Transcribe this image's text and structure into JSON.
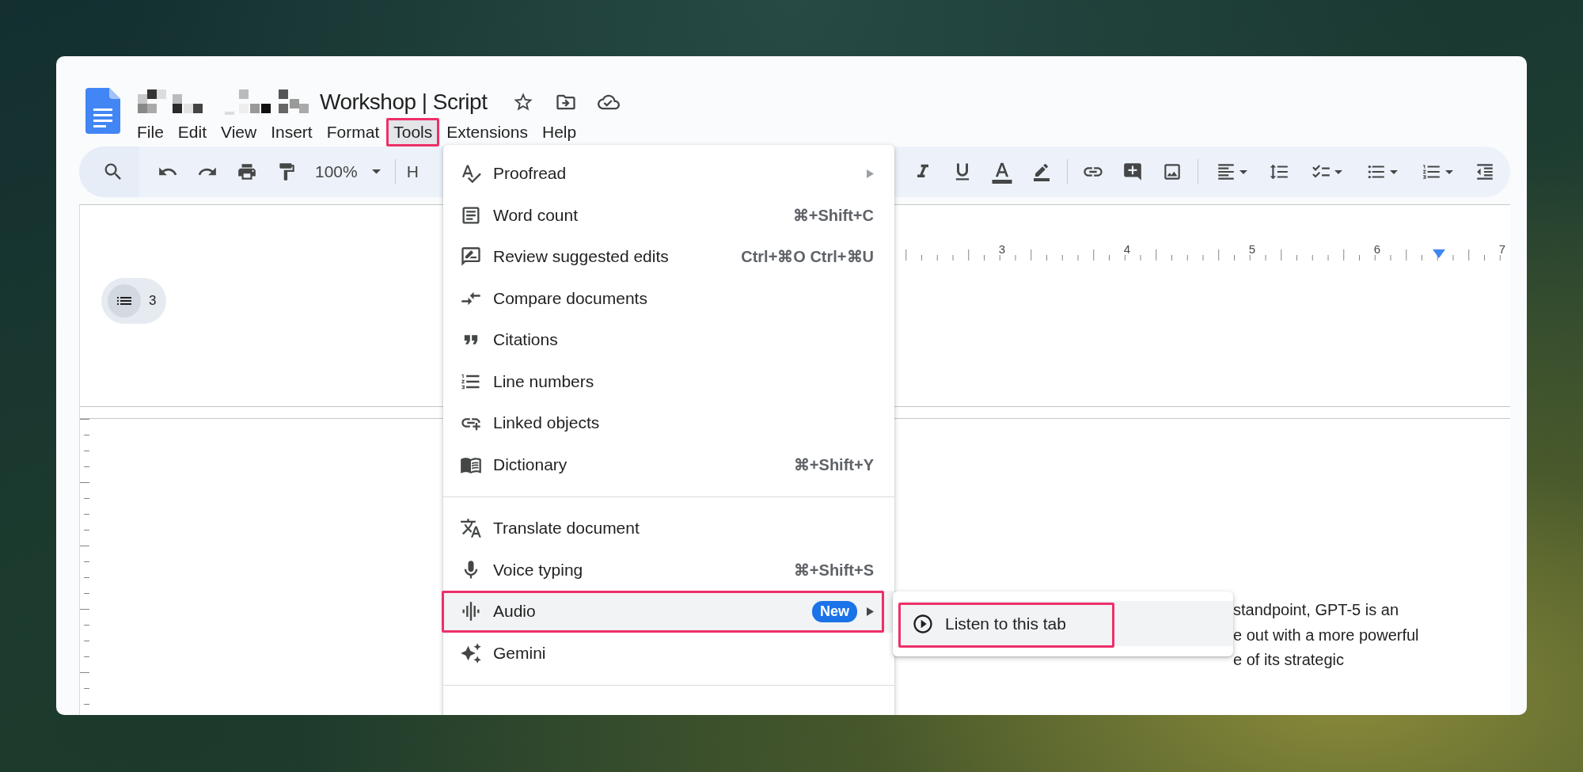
{
  "document": {
    "title": "Workshop | Script",
    "title_redacted": true
  },
  "menu_bar": [
    {
      "label": "File",
      "selected": false,
      "annotated": false
    },
    {
      "label": "Edit",
      "selected": false,
      "annotated": false
    },
    {
      "label": "View",
      "selected": false,
      "annotated": false
    },
    {
      "label": "Insert",
      "selected": false,
      "annotated": false
    },
    {
      "label": "Format",
      "selected": false,
      "annotated": false
    },
    {
      "label": "Tools",
      "selected": true,
      "annotated": true
    },
    {
      "label": "Extensions",
      "selected": false,
      "annotated": false
    },
    {
      "label": "Help",
      "selected": false,
      "annotated": false
    }
  ],
  "toolbar": {
    "zoom": "100%",
    "style": "H"
  },
  "ruler": {
    "marks": [
      "3",
      "4",
      "5",
      "6",
      "7"
    ]
  },
  "outline": {
    "count": "3"
  },
  "tools_menu": {
    "groups": [
      [
        {
          "label": "Proofread",
          "has_submenu": true,
          "selected": false,
          "annotated": false
        },
        {
          "label": "Word count",
          "shortcut": "⌘+Shift+C",
          "has_submenu": false,
          "selected": false,
          "annotated": false
        },
        {
          "label": "Review suggested edits",
          "shortcut": "Ctrl+⌘O Ctrl+⌘U",
          "has_submenu": false,
          "selected": false,
          "annotated": false
        },
        {
          "label": "Compare documents",
          "has_submenu": false,
          "selected": false,
          "annotated": false
        },
        {
          "label": "Citations",
          "has_submenu": false,
          "selected": false,
          "annotated": false
        },
        {
          "label": "Line numbers",
          "has_submenu": false,
          "selected": false,
          "annotated": false
        },
        {
          "label": "Linked objects",
          "has_submenu": false,
          "selected": false,
          "annotated": false
        },
        {
          "label": "Dictionary",
          "shortcut": "⌘+Shift+Y",
          "has_submenu": false,
          "selected": false,
          "annotated": false
        }
      ],
      [
        {
          "label": "Translate document",
          "has_submenu": false,
          "selected": false,
          "annotated": false
        },
        {
          "label": "Voice typing",
          "shortcut": "⌘+Shift+S",
          "has_submenu": false,
          "selected": false,
          "annotated": false
        },
        {
          "label": "Audio",
          "badge": "New",
          "has_submenu": true,
          "selected": true,
          "annotated": true
        },
        {
          "label": "Gemini",
          "has_submenu": false,
          "selected": false,
          "annotated": false
        }
      ]
    ]
  },
  "submenu": {
    "items": [
      {
        "label": "Listen to this tab",
        "selected": true,
        "annotated": true
      }
    ]
  },
  "document_text": [
    "standpoint, GPT-5 is an",
    "e out with a more powerful",
    "e of its strategic"
  ]
}
